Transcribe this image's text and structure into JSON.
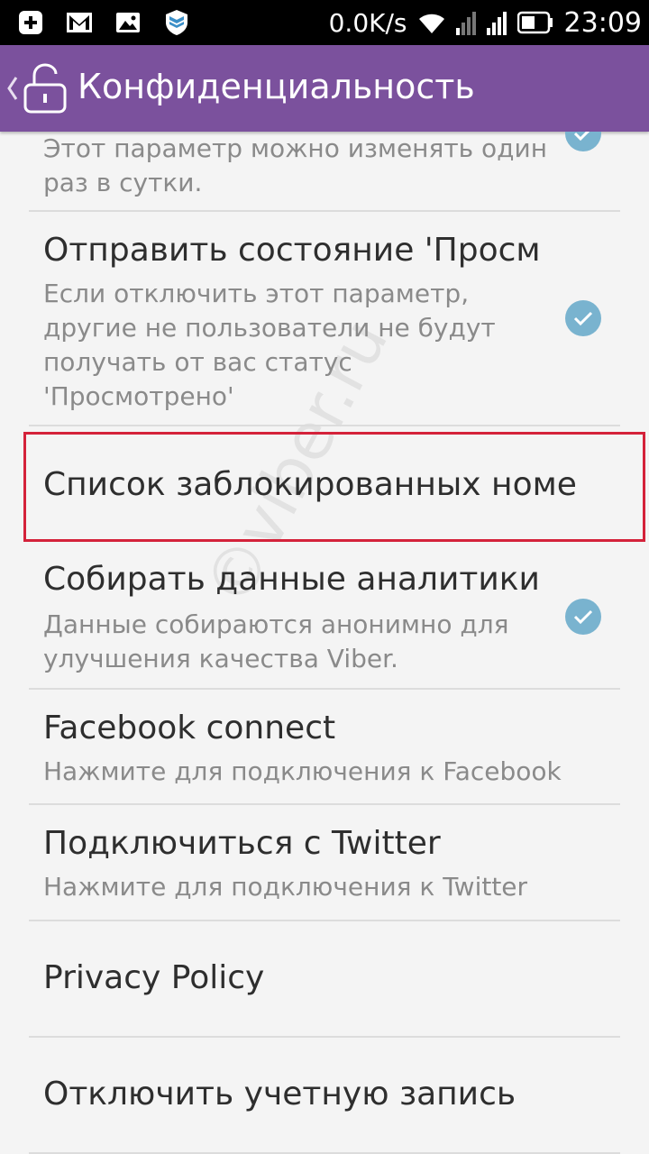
{
  "status_bar": {
    "speed": "0.0K/s",
    "time": "23:09"
  },
  "action_bar": {
    "title": "Конфиденциальность"
  },
  "items": [
    {
      "summary": "Этот параметр можно изменять один раз в сутки.",
      "checked": true
    },
    {
      "title": "Отправить состояние 'Просм",
      "summary": "Если отключить этот параметр, другие не пользователи не будут получать от вас статус 'Просмотрено'",
      "checked": true
    },
    {
      "title": "Список заблокированных номе"
    },
    {
      "title": "Собирать данные аналитики",
      "summary": "Данные собираются анонимно для улучшения качества Viber.",
      "checked": true
    },
    {
      "title": "Facebook connect",
      "summary": "Нажмите для подключения к Facebook"
    },
    {
      "title": "Подключиться с Twitter",
      "summary": "Нажмите для подключения к Twitter"
    },
    {
      "title": "Privacy Policy"
    },
    {
      "title": "Отключить учетную запись"
    }
  ],
  "watermark": "©viber.ru",
  "colors": {
    "action_bar": "#7b519d",
    "check": "#79b3cf",
    "highlight": "#d4223a"
  }
}
